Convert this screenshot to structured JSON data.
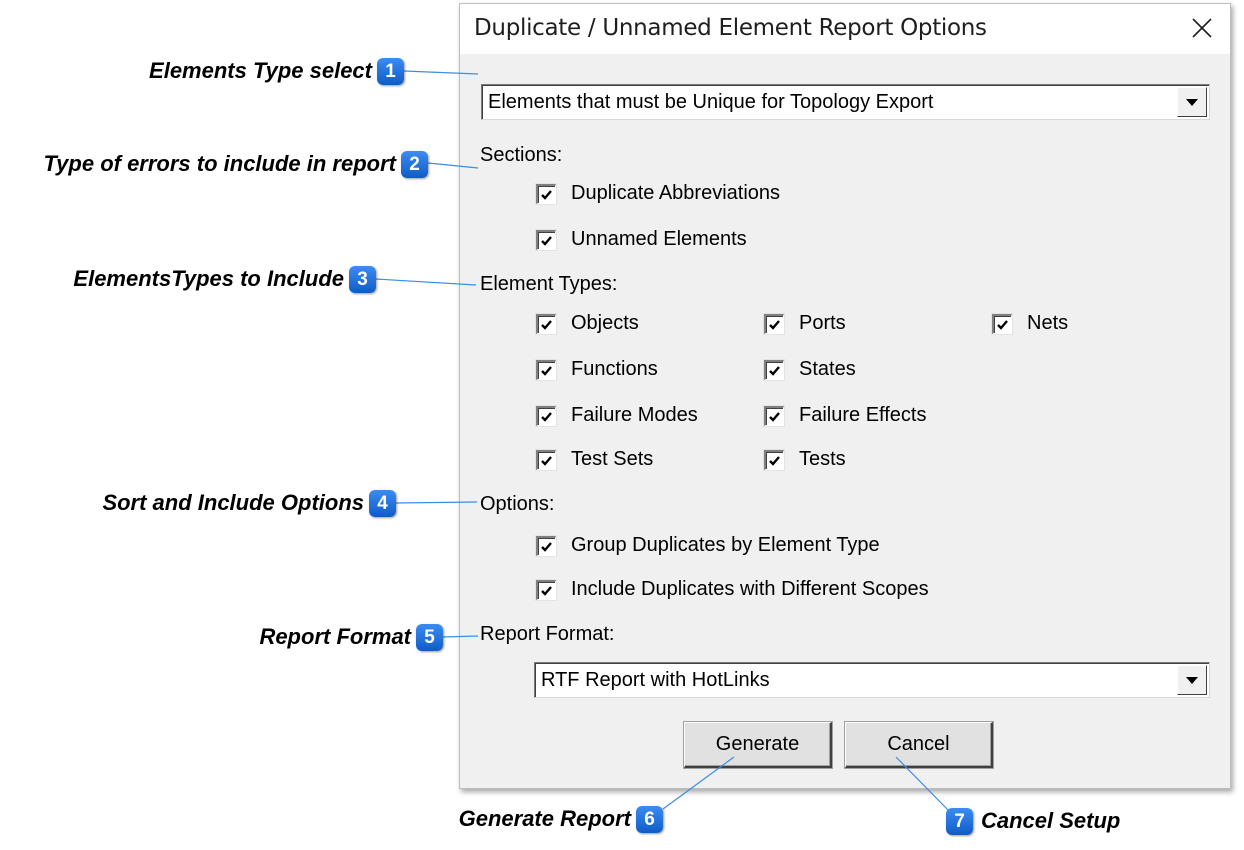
{
  "dialog": {
    "title": "Duplicate / Unnamed Element Report Options",
    "element_type_select": {
      "value": "Elements that must be Unique for Topology Export"
    },
    "sections": {
      "label": "Sections:",
      "items": [
        {
          "label": "Duplicate Abbreviations",
          "checked": true
        },
        {
          "label": "Unnamed Elements",
          "checked": true
        }
      ]
    },
    "element_types": {
      "label": "Element Types:",
      "items": [
        {
          "label": "Objects",
          "checked": true
        },
        {
          "label": "Ports",
          "checked": true
        },
        {
          "label": "Nets",
          "checked": true
        },
        {
          "label": "Functions",
          "checked": true
        },
        {
          "label": "States",
          "checked": true
        },
        {
          "label": "Failure Modes",
          "checked": true
        },
        {
          "label": "Failure Effects",
          "checked": true
        },
        {
          "label": "Test Sets",
          "checked": true
        },
        {
          "label": "Tests",
          "checked": true
        }
      ]
    },
    "options": {
      "label": "Options:",
      "items": [
        {
          "label": "Group Duplicates by Element Type",
          "checked": true
        },
        {
          "label": "Include Duplicates with Different Scopes",
          "checked": true
        }
      ]
    },
    "report_format": {
      "label": "Report Format:",
      "value": "RTF Report with HotLinks"
    },
    "buttons": {
      "generate": "Generate",
      "cancel": "Cancel"
    }
  },
  "callouts": [
    {
      "number": "1",
      "text": "Elements Type select"
    },
    {
      "number": "2",
      "text": "Type of errors to include in report"
    },
    {
      "number": "3",
      "text": "ElementsTypes to Include"
    },
    {
      "number": "4",
      "text": "Sort and Include Options"
    },
    {
      "number": "5",
      "text": "Report Format"
    },
    {
      "number": "6",
      "text": "Generate Report"
    },
    {
      "number": "7",
      "text": "Cancel Setup"
    }
  ],
  "colors": {
    "badge": "#1a6fe0",
    "leader_line": "#3a8ee6",
    "dialog_bg": "#f0f0f0"
  }
}
